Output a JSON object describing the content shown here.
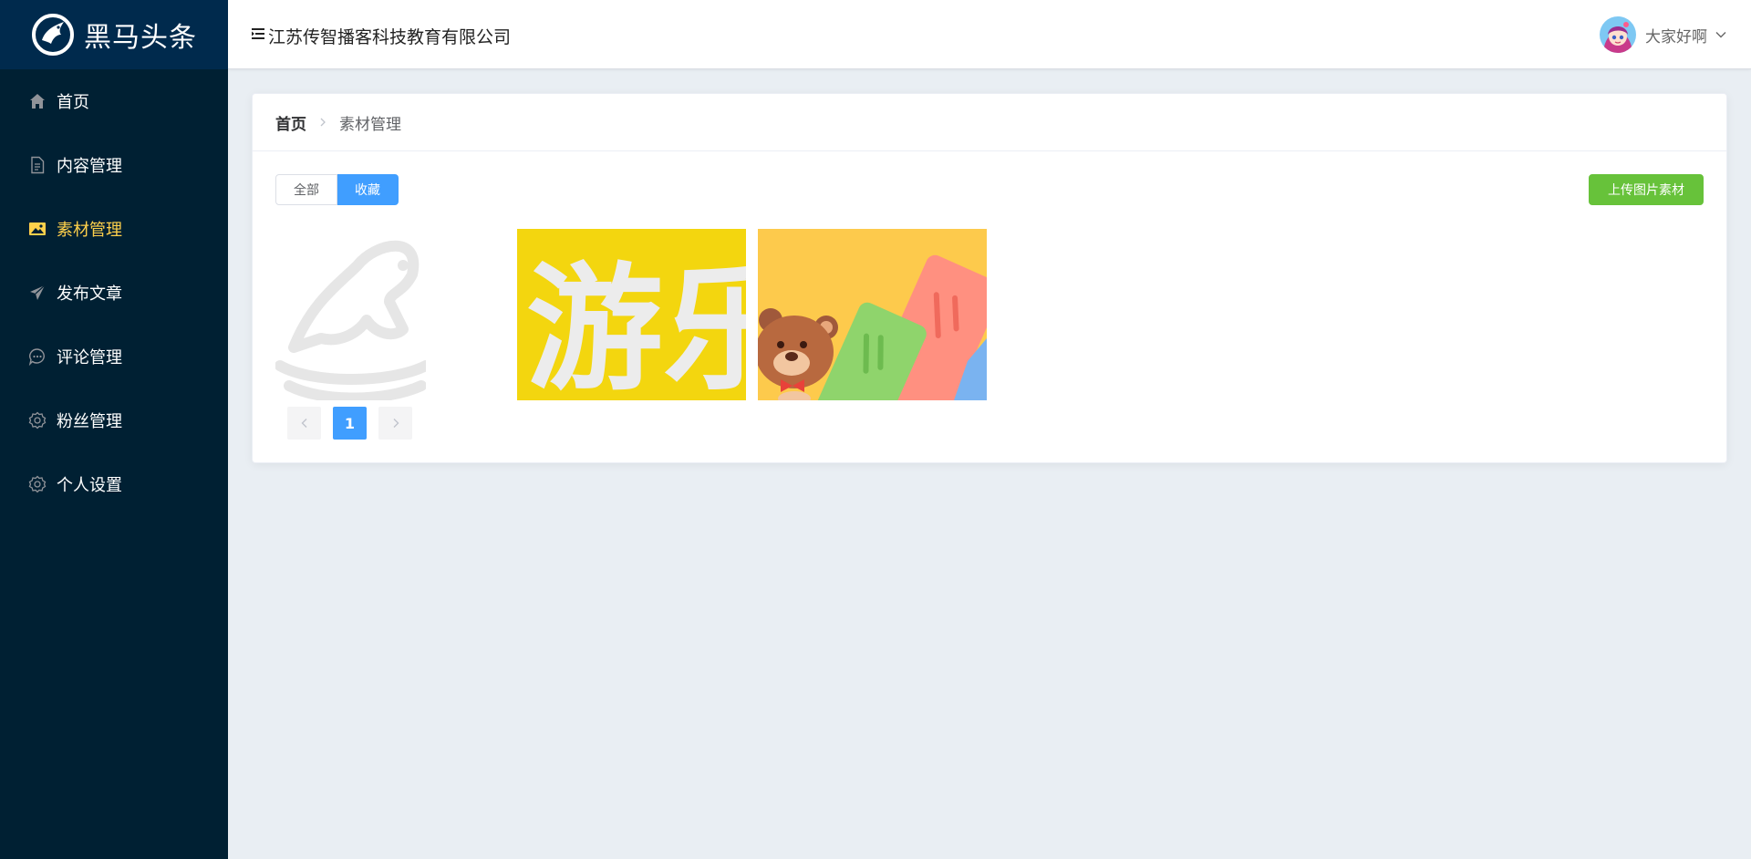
{
  "app": {
    "logo_text": "黑马头条"
  },
  "sidebar": {
    "items": [
      {
        "label": "首页",
        "icon": "home-icon"
      },
      {
        "label": "内容管理",
        "icon": "document-icon"
      },
      {
        "label": "素材管理",
        "icon": "picture-icon",
        "active": true
      },
      {
        "label": "发布文章",
        "icon": "send-icon"
      },
      {
        "label": "评论管理",
        "icon": "chat-icon"
      },
      {
        "label": "粉丝管理",
        "icon": "gear-icon"
      },
      {
        "label": "个人设置",
        "icon": "gear-icon"
      }
    ]
  },
  "header": {
    "company": "江苏传智播客科技教育有限公司",
    "username": "大家好啊"
  },
  "breadcrumb": {
    "home": "首页",
    "current": "素材管理"
  },
  "toolbar": {
    "all_label": "全部",
    "collect_label": "收藏",
    "selected": "收藏",
    "upload_label": "上传图片素材"
  },
  "images": [
    {
      "name": "placeholder-rocking-horse"
    },
    {
      "name": "yellow-text-banner",
      "text": "游乐"
    },
    {
      "name": "bear-cards-illustration"
    }
  ],
  "pagination": {
    "current": "1"
  },
  "colors": {
    "sidebar_bg": "#002033",
    "active_menu": "#ffd04b",
    "primary": "#409eff",
    "success": "#67c23a"
  }
}
